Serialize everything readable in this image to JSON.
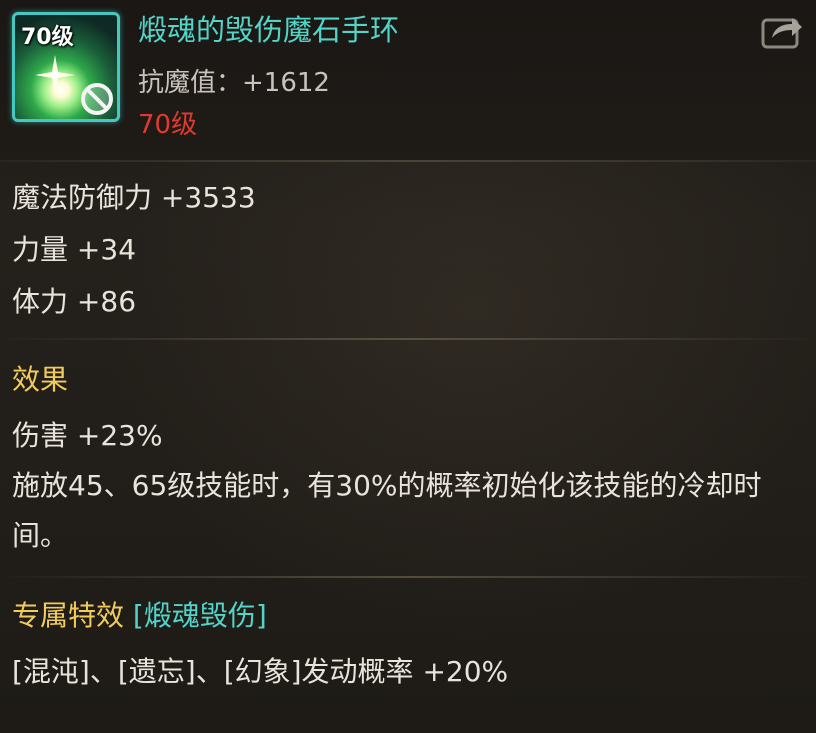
{
  "item": {
    "icon_level": "70级",
    "name": "煅魂的毁伤魔石手环",
    "resist_label": "抗魔值：",
    "resist_value": "+1612",
    "required_level": "70级",
    "icon": "bracelet-gem-icon",
    "share_icon": "share-icon"
  },
  "stats": [
    {
      "label": "魔法防御力",
      "value": "+3533"
    },
    {
      "label": "力量",
      "value": "+34"
    },
    {
      "label": "体力",
      "value": "+86"
    }
  ],
  "effect": {
    "title": "效果",
    "damage": "伤害 +23%",
    "description": "施放45、65级技能时，有30%的概率初始化该技能的冷却时间。"
  },
  "exclusive": {
    "title": "专属特效",
    "set_name": "[煅魂毁伤]",
    "text": "[混沌]、[遗忘]、[幻象]发动概率 +20%"
  },
  "colors": {
    "name": "#52d4c8",
    "level_requirement": "#e03a2e",
    "section_title": "#f2cc5a",
    "body_text": "#e8e4dc"
  }
}
